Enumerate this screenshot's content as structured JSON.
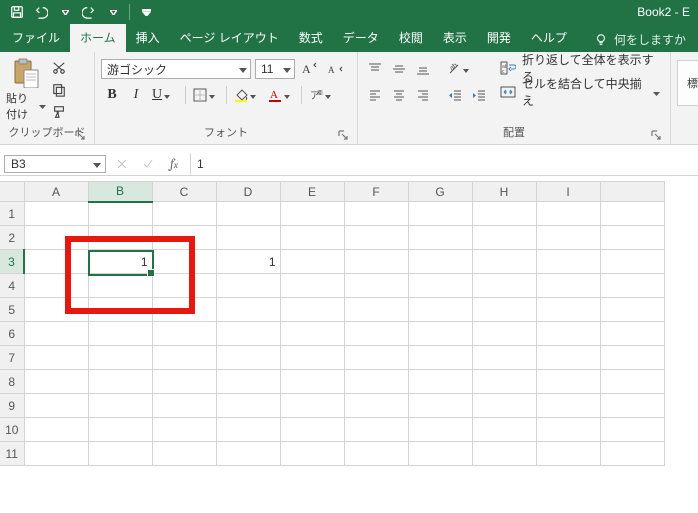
{
  "title": "Book2  -  E",
  "tabs": {
    "file": "ファイル",
    "home": "ホーム",
    "insert": "挿入",
    "pagelayout": "ページ レイアウト",
    "formulas": "数式",
    "data": "データ",
    "review": "校閲",
    "view": "表示",
    "developer": "開発",
    "help": "ヘルプ",
    "tellme": "何をしますか"
  },
  "ribbon": {
    "clipboard": {
      "paste": "貼り付け",
      "group": "クリップボード"
    },
    "font": {
      "name": "游ゴシック",
      "size": "11",
      "group": "フォント"
    },
    "alignment": {
      "wrap": "折り返して全体を表示する",
      "merge": "セルを結合して中央揃え",
      "group": "配置"
    },
    "styles": {
      "normal": "標準"
    }
  },
  "formula": {
    "namebox": "B3",
    "value": "1"
  },
  "grid": {
    "columns": [
      "A",
      "B",
      "C",
      "D",
      "E",
      "F",
      "G",
      "H",
      "I"
    ],
    "rows": [
      "1",
      "2",
      "3",
      "4",
      "5",
      "6",
      "7",
      "8",
      "9",
      "10",
      "11"
    ],
    "selected_col_index": 1,
    "selected_row_index": 2,
    "cells": {
      "B3": "1",
      "D3": "1"
    }
  }
}
